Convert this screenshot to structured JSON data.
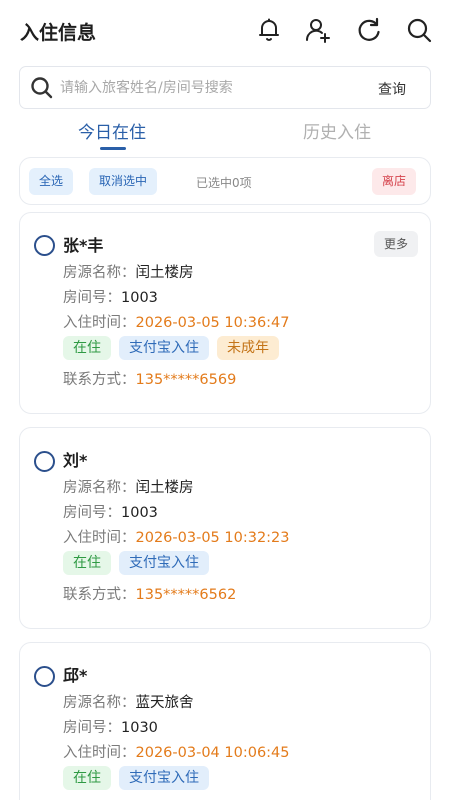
{
  "header": {
    "title": "入住信息",
    "icons": [
      "bell-icon",
      "add-user-icon",
      "refresh-icon",
      "search-icon"
    ]
  },
  "search": {
    "placeholder": "请输入旅客姓名/房间号搜索",
    "value": "",
    "button_label": "查询"
  },
  "tabs": [
    {
      "label": "今日在住",
      "active": true
    },
    {
      "label": "历史入住",
      "active": false
    }
  ],
  "selection": {
    "select_all": "全选",
    "deselect": "取消选中",
    "count_text": "已选中0项",
    "checkout": "离店"
  },
  "labels": {
    "property": "房源名称：",
    "room": "房间号：",
    "checkin_time": "入住时间：",
    "contact": "联系方式："
  },
  "more_label": "更多",
  "cards": [
    {
      "name": "张*丰",
      "property": "闰土楼房",
      "room": "1003",
      "checkin_time": "2026-03-05 10:36:47",
      "tags": [
        {
          "text": "在住",
          "color": "green"
        },
        {
          "text": "支付宝入住",
          "color": "blue"
        },
        {
          "text": "未成年",
          "color": "orange"
        }
      ],
      "contact": "135*****6569"
    },
    {
      "name": "刘*",
      "property": "闰土楼房",
      "room": "1003",
      "checkin_time": "2026-03-05 10:32:23",
      "tags": [
        {
          "text": "在住",
          "color": "green"
        },
        {
          "text": "支付宝入住",
          "color": "blue"
        }
      ],
      "contact": "135*****6562"
    },
    {
      "name": "邱*",
      "property": "蓝天旅舍",
      "room": "1030",
      "checkin_time": "2026-03-04 10:06:45",
      "tags": [
        {
          "text": "在住",
          "color": "green"
        },
        {
          "text": "支付宝入住",
          "color": "blue"
        }
      ],
      "contact": ""
    }
  ],
  "colors": {
    "accent": "#2a5fa8",
    "highlight_orange": "#e37b1b",
    "danger": "#d5434c"
  }
}
